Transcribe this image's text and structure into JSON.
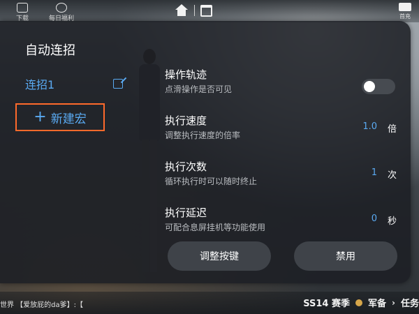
{
  "top_bar": {
    "left_buttons": [
      {
        "label": "下载",
        "icon": "download-icon"
      },
      {
        "label": "每日福利",
        "icon": "gift-icon"
      }
    ],
    "center_icons": [
      "home-icon",
      "calendar-icon"
    ],
    "right_button": {
      "label": "首充",
      "icon": "mail-icon"
    }
  },
  "panel": {
    "title": "自动连招",
    "macros": [
      {
        "label": "连招1",
        "icon": "edit-icon"
      }
    ],
    "new_macro": {
      "plus": "+",
      "label": "新建宏"
    },
    "settings": {
      "trajectory": {
        "title": "操作轨迹",
        "desc": "点滑操作是否可见",
        "toggle_on": false
      },
      "speed": {
        "title": "执行速度",
        "desc": "调整执行速度的倍率",
        "value": "1.0",
        "unit": "倍"
      },
      "count": {
        "title": "执行次数",
        "desc": "循环执行时可以随时终止",
        "value": "1",
        "unit": "次"
      },
      "delay": {
        "title": "执行延迟",
        "desc": "可配合息屏挂机等功能使用",
        "value": "0",
        "unit": "秒"
      }
    },
    "buttons": {
      "adjust": "调整按键",
      "disable": "禁用"
    }
  },
  "bottom_bar": {
    "chat_text": "世界 【爱放屁的da爹】:【",
    "season": "SS14 赛季",
    "armory": "军备",
    "tasks": "任务",
    "chevron": "›"
  },
  "colors": {
    "accent": "#5aaaf2",
    "highlight_border": "#ff6a2b"
  }
}
